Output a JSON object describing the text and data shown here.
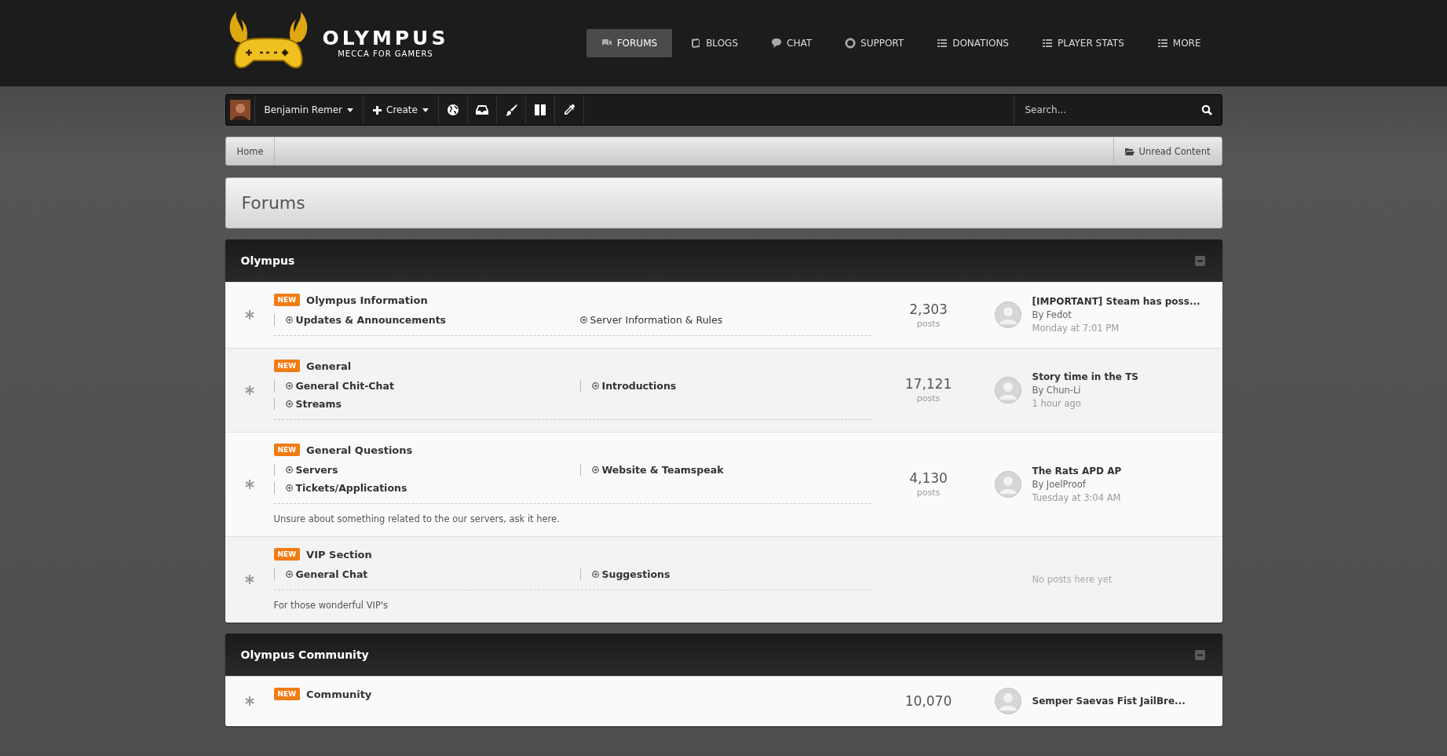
{
  "logo": {
    "title": "OLYMPUS",
    "tagline": "MECCA FOR GAMERS"
  },
  "nav": [
    {
      "label": "FORUMS",
      "kind": "comments",
      "selected": true
    },
    {
      "label": "BLOGS",
      "kind": "book",
      "selected": false
    },
    {
      "label": "CHAT",
      "kind": "comment",
      "selected": false
    },
    {
      "label": "SUPPORT",
      "kind": "lifebuoy",
      "selected": false
    },
    {
      "label": "DONATIONS",
      "kind": "list",
      "selected": false
    },
    {
      "label": "PLAYER STATS",
      "kind": "list",
      "selected": false
    },
    {
      "label": "MORE",
      "kind": "list",
      "selected": false
    }
  ],
  "user_bar": {
    "user_name": "Benjamin Remer",
    "create": "Create",
    "search": {
      "placeholder": "Search..."
    }
  },
  "breadcrumb": {
    "items": [
      "Home"
    ],
    "unread_link": "Unread Content"
  },
  "page_title": "Forums",
  "categories": [
    {
      "title": "Olympus",
      "forums": [
        {
          "badge": "NEW",
          "title": "Olympus Information",
          "subforums": [
            {
              "label": "Updates & Announcements",
              "unread": true
            },
            {
              "label": "Server Information & Rules",
              "unread": false
            }
          ],
          "count": "2,303",
          "count_label": "posts",
          "last_post": {
            "title": "[IMPORTANT] Steam has poss...",
            "author": "By Fedot",
            "time": "Monday at 7:01 PM"
          }
        },
        {
          "badge": "NEW",
          "title": "General",
          "subforums": [
            {
              "label": "General Chit-Chat",
              "unread": true
            },
            {
              "label": "Introductions",
              "unread": true
            },
            {
              "label": "Streams",
              "unread": true
            }
          ],
          "count": "17,121",
          "count_label": "posts",
          "last_post": {
            "title": "Story time in the TS",
            "author": "By Chun-Li",
            "time": "1 hour ago"
          }
        },
        {
          "badge": "NEW",
          "title": "General Questions",
          "subforums": [
            {
              "label": "Servers",
              "unread": true
            },
            {
              "label": "Website & Teamspeak",
              "unread": true
            },
            {
              "label": "Tickets/Applications",
              "unread": true
            }
          ],
          "description": "Unsure about something related to the our servers, ask it here.",
          "count": "4,130",
          "count_label": "posts",
          "last_post": {
            "title": "The Rats APD AP",
            "author": "By JoelProof",
            "time": "Tuesday at 3:04 AM"
          }
        },
        {
          "badge": "NEW",
          "title": "VIP Section",
          "subforums": [
            {
              "label": "General Chat",
              "unread": true
            },
            {
              "label": "Suggestions",
              "unread": true
            }
          ],
          "description": "For those wonderful VIP's",
          "empty_text": "No posts here yet"
        }
      ]
    },
    {
      "title": "Olympus Community",
      "forums": [
        {
          "badge": "NEW",
          "title": "Community",
          "count": "10,070",
          "last_post": {
            "title": "Semper Saevas Fist JailBre..."
          }
        }
      ]
    }
  ]
}
